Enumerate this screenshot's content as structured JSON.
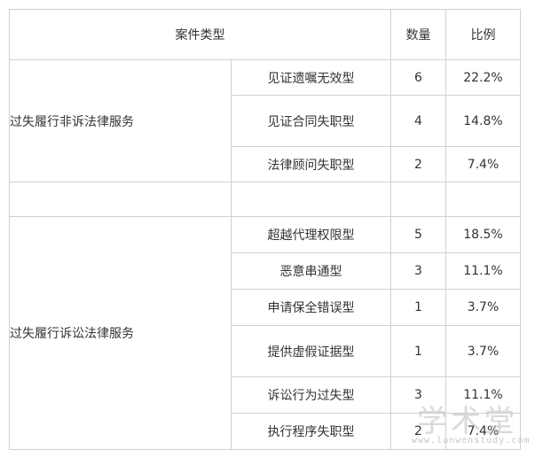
{
  "header": {
    "case_type": "案件类型",
    "count": "数量",
    "ratio": "比例"
  },
  "groups": [
    {
      "label": "过失履行非诉法律服务"
    },
    {
      "label": "过失履行诉讼法律服务"
    }
  ],
  "rows": [
    {
      "subtype": "见证遗嘱无效型",
      "count": "6",
      "ratio": "22.2%"
    },
    {
      "subtype": "见证合同失职型",
      "count": "4",
      "ratio": "14.8%"
    },
    {
      "subtype": "法律顾问失职型",
      "count": "2",
      "ratio": "7.4%"
    },
    {
      "subtype": "",
      "count": "",
      "ratio": ""
    },
    {
      "subtype": "超越代理权限型",
      "count": "5",
      "ratio": "18.5%"
    },
    {
      "subtype": "恶意串通型",
      "count": "3",
      "ratio": "11.1%"
    },
    {
      "subtype": "申请保全错误型",
      "count": "1",
      "ratio": "3.7%"
    },
    {
      "subtype": "提供虚假证据型",
      "count": "1",
      "ratio": "3.7%"
    },
    {
      "subtype": "诉讼行为过失型",
      "count": "3",
      "ratio": "11.1%"
    },
    {
      "subtype": "执行程序失职型",
      "count": "2",
      "ratio": "7.4%"
    }
  ],
  "watermark": {
    "title": "学术堂",
    "url": "www.lunwenstudy.com"
  }
}
